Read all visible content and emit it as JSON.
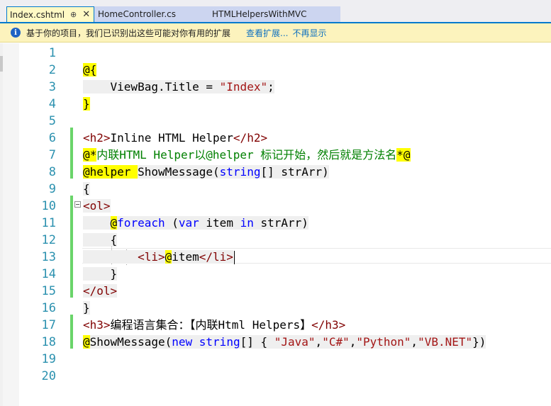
{
  "tabs": [
    {
      "label": "Index.cshtml",
      "pin": "⊕",
      "close": "✕"
    },
    {
      "label": "HomeController.cs"
    },
    {
      "label": "HTMLHelpersWithMVC"
    }
  ],
  "infobar": {
    "icon": "i",
    "message": "基于你的项目，我们已识别出这些可能对你有用的扩展",
    "link_view": "查看扩展...",
    "link_hide": "不再显示"
  },
  "line_numbers": [
    "1",
    "2",
    "3",
    "4",
    "5",
    "6",
    "7",
    "8",
    "9",
    "10",
    "11",
    "12",
    "13",
    "14",
    "15",
    "16",
    "17",
    "18",
    "19",
    "20"
  ],
  "code": {
    "l2": "@{",
    "l3": {
      "indent": "    ",
      "text": "ViewBag.Title = ",
      "str": "\"Index\"",
      "end": ";"
    },
    "l4": "}",
    "l6": {
      "open": "<h2>",
      "text": "Inline HTML Helper",
      "close": "</h2>"
    },
    "l7": {
      "start": "@*",
      "comment": "内联HTML Helper以@helper 标记开始，然后就是方法名",
      "end": "*@"
    },
    "l8": {
      "kw": "@helper ",
      "name": "ShowMessage(",
      "type": "string",
      "rest": "[] strArr)"
    },
    "l9": "{",
    "l10": {
      "tag": "<ol>"
    },
    "l11": {
      "indent": "    ",
      "at": "@",
      "kw": "foreach",
      "sp": " (",
      "kw2": "var",
      "mid": " item ",
      "kw3": "in",
      "rest": " strArr)"
    },
    "l12": {
      "indent": "    ",
      "text": "{"
    },
    "l13": {
      "indent": "        ",
      "open": "<li>",
      "at": "@",
      "expr": "item",
      "close": "</li>"
    },
    "l14": {
      "indent": "    ",
      "text": "}"
    },
    "l15": {
      "tag": "</ol>"
    },
    "l16": "}",
    "l17": {
      "open": "<h3>",
      "text": "编程语言集合：【内联Html Helpers】",
      "close": "</h3>"
    },
    "l18": {
      "at": "@",
      "name": "ShowMessage(",
      "kw": "new",
      "sp": " ",
      "type": "string",
      "mid": "[] { ",
      "s1": "\"Java\"",
      "c1": ",",
      "s2": "\"C#\"",
      "c2": ",",
      "s3": "\"Python\"",
      "c3": ",",
      "s4": "\"VB.NET\"",
      "end": "})"
    }
  },
  "colors": {
    "accent": "#007acc",
    "line_number": "#2b91af",
    "razor_highlight": "#ffff00",
    "change_bar": "#6ad46a",
    "html_tag": "#800000",
    "keyword": "#0000ff",
    "string": "#a31515",
    "comment": "#008000"
  }
}
